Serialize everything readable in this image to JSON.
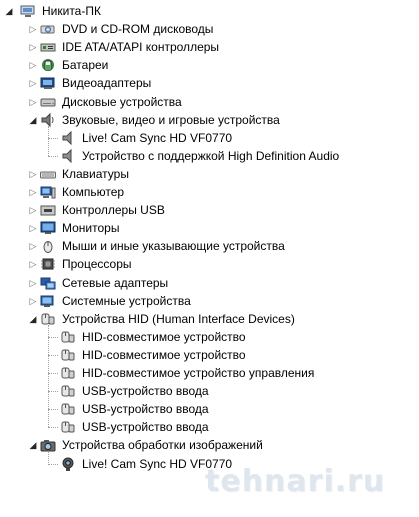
{
  "root": {
    "label": "Никита-ПК"
  },
  "categories": [
    {
      "label": "DVD и CD-ROM дисководы",
      "icon": "dvd-drive-icon"
    },
    {
      "label": "IDE ATA/ATAPI контроллеры",
      "icon": "ide-controller-icon"
    },
    {
      "label": "Батареи",
      "icon": "battery-icon"
    },
    {
      "label": "Видеоадаптеры",
      "icon": "display-adapter-icon"
    },
    {
      "label": "Дисковые устройства",
      "icon": "disk-drive-icon"
    },
    {
      "label": "Звуковые, видео и игровые устройства",
      "icon": "speaker-icon",
      "expanded": true,
      "children": [
        {
          "label": "Live! Cam Sync HD VF0770",
          "icon": "audio-device-icon"
        },
        {
          "label": "Устройство с поддержкой High Definition Audio",
          "icon": "audio-device-icon"
        }
      ]
    },
    {
      "label": "Клавиатуры",
      "icon": "keyboard-icon"
    },
    {
      "label": "Компьютер",
      "icon": "computer-icon"
    },
    {
      "label": "Контроллеры USB",
      "icon": "usb-controller-icon"
    },
    {
      "label": "Мониторы",
      "icon": "monitor-icon"
    },
    {
      "label": "Мыши и иные указывающие устройства",
      "icon": "mouse-icon"
    },
    {
      "label": "Процессоры",
      "icon": "processor-icon"
    },
    {
      "label": "Сетевые адаптеры",
      "icon": "network-adapter-icon"
    },
    {
      "label": "Системные устройства",
      "icon": "system-device-icon"
    },
    {
      "label": "Устройства HID (Human Interface Devices)",
      "icon": "hid-icon",
      "expanded": true,
      "children": [
        {
          "label": "HID-совместимое устройство",
          "icon": "hid-device-icon"
        },
        {
          "label": "HID-совместимое устройство",
          "icon": "hid-device-icon"
        },
        {
          "label": "HID-совместимое устройство управления",
          "icon": "hid-device-icon"
        },
        {
          "label": "USB-устройство ввода",
          "icon": "hid-device-icon"
        },
        {
          "label": "USB-устройство ввода",
          "icon": "hid-device-icon"
        },
        {
          "label": "USB-устройство ввода",
          "icon": "hid-device-icon"
        }
      ]
    },
    {
      "label": "Устройства обработки изображений",
      "icon": "camera-icon",
      "expanded": true,
      "children": [
        {
          "label": "Live! Cam Sync HD VF0770",
          "icon": "webcam-icon"
        }
      ]
    }
  ],
  "watermark": "tehnari.ru"
}
